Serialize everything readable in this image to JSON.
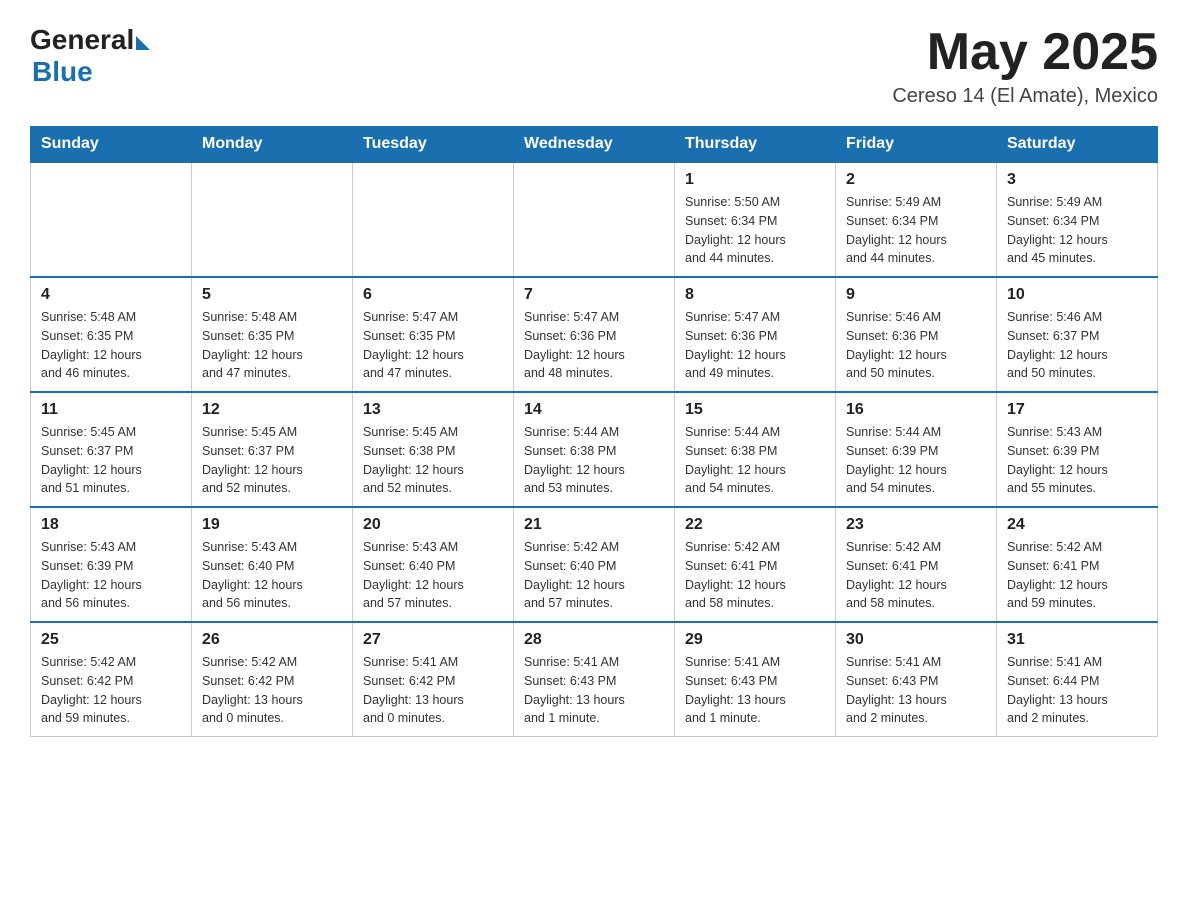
{
  "header": {
    "logo_general": "General",
    "logo_blue": "Blue",
    "month_title": "May 2025",
    "location": "Cereso 14 (El Amate), Mexico"
  },
  "days_of_week": [
    "Sunday",
    "Monday",
    "Tuesday",
    "Wednesday",
    "Thursday",
    "Friday",
    "Saturday"
  ],
  "weeks": [
    [
      {
        "day": "",
        "info": ""
      },
      {
        "day": "",
        "info": ""
      },
      {
        "day": "",
        "info": ""
      },
      {
        "day": "",
        "info": ""
      },
      {
        "day": "1",
        "info": "Sunrise: 5:50 AM\nSunset: 6:34 PM\nDaylight: 12 hours\nand 44 minutes."
      },
      {
        "day": "2",
        "info": "Sunrise: 5:49 AM\nSunset: 6:34 PM\nDaylight: 12 hours\nand 44 minutes."
      },
      {
        "day": "3",
        "info": "Sunrise: 5:49 AM\nSunset: 6:34 PM\nDaylight: 12 hours\nand 45 minutes."
      }
    ],
    [
      {
        "day": "4",
        "info": "Sunrise: 5:48 AM\nSunset: 6:35 PM\nDaylight: 12 hours\nand 46 minutes."
      },
      {
        "day": "5",
        "info": "Sunrise: 5:48 AM\nSunset: 6:35 PM\nDaylight: 12 hours\nand 47 minutes."
      },
      {
        "day": "6",
        "info": "Sunrise: 5:47 AM\nSunset: 6:35 PM\nDaylight: 12 hours\nand 47 minutes."
      },
      {
        "day": "7",
        "info": "Sunrise: 5:47 AM\nSunset: 6:36 PM\nDaylight: 12 hours\nand 48 minutes."
      },
      {
        "day": "8",
        "info": "Sunrise: 5:47 AM\nSunset: 6:36 PM\nDaylight: 12 hours\nand 49 minutes."
      },
      {
        "day": "9",
        "info": "Sunrise: 5:46 AM\nSunset: 6:36 PM\nDaylight: 12 hours\nand 50 minutes."
      },
      {
        "day": "10",
        "info": "Sunrise: 5:46 AM\nSunset: 6:37 PM\nDaylight: 12 hours\nand 50 minutes."
      }
    ],
    [
      {
        "day": "11",
        "info": "Sunrise: 5:45 AM\nSunset: 6:37 PM\nDaylight: 12 hours\nand 51 minutes."
      },
      {
        "day": "12",
        "info": "Sunrise: 5:45 AM\nSunset: 6:37 PM\nDaylight: 12 hours\nand 52 minutes."
      },
      {
        "day": "13",
        "info": "Sunrise: 5:45 AM\nSunset: 6:38 PM\nDaylight: 12 hours\nand 52 minutes."
      },
      {
        "day": "14",
        "info": "Sunrise: 5:44 AM\nSunset: 6:38 PM\nDaylight: 12 hours\nand 53 minutes."
      },
      {
        "day": "15",
        "info": "Sunrise: 5:44 AM\nSunset: 6:38 PM\nDaylight: 12 hours\nand 54 minutes."
      },
      {
        "day": "16",
        "info": "Sunrise: 5:44 AM\nSunset: 6:39 PM\nDaylight: 12 hours\nand 54 minutes."
      },
      {
        "day": "17",
        "info": "Sunrise: 5:43 AM\nSunset: 6:39 PM\nDaylight: 12 hours\nand 55 minutes."
      }
    ],
    [
      {
        "day": "18",
        "info": "Sunrise: 5:43 AM\nSunset: 6:39 PM\nDaylight: 12 hours\nand 56 minutes."
      },
      {
        "day": "19",
        "info": "Sunrise: 5:43 AM\nSunset: 6:40 PM\nDaylight: 12 hours\nand 56 minutes."
      },
      {
        "day": "20",
        "info": "Sunrise: 5:43 AM\nSunset: 6:40 PM\nDaylight: 12 hours\nand 57 minutes."
      },
      {
        "day": "21",
        "info": "Sunrise: 5:42 AM\nSunset: 6:40 PM\nDaylight: 12 hours\nand 57 minutes."
      },
      {
        "day": "22",
        "info": "Sunrise: 5:42 AM\nSunset: 6:41 PM\nDaylight: 12 hours\nand 58 minutes."
      },
      {
        "day": "23",
        "info": "Sunrise: 5:42 AM\nSunset: 6:41 PM\nDaylight: 12 hours\nand 58 minutes."
      },
      {
        "day": "24",
        "info": "Sunrise: 5:42 AM\nSunset: 6:41 PM\nDaylight: 12 hours\nand 59 minutes."
      }
    ],
    [
      {
        "day": "25",
        "info": "Sunrise: 5:42 AM\nSunset: 6:42 PM\nDaylight: 12 hours\nand 59 minutes."
      },
      {
        "day": "26",
        "info": "Sunrise: 5:42 AM\nSunset: 6:42 PM\nDaylight: 13 hours\nand 0 minutes."
      },
      {
        "day": "27",
        "info": "Sunrise: 5:41 AM\nSunset: 6:42 PM\nDaylight: 13 hours\nand 0 minutes."
      },
      {
        "day": "28",
        "info": "Sunrise: 5:41 AM\nSunset: 6:43 PM\nDaylight: 13 hours\nand 1 minute."
      },
      {
        "day": "29",
        "info": "Sunrise: 5:41 AM\nSunset: 6:43 PM\nDaylight: 13 hours\nand 1 minute."
      },
      {
        "day": "30",
        "info": "Sunrise: 5:41 AM\nSunset: 6:43 PM\nDaylight: 13 hours\nand 2 minutes."
      },
      {
        "day": "31",
        "info": "Sunrise: 5:41 AM\nSunset: 6:44 PM\nDaylight: 13 hours\nand 2 minutes."
      }
    ]
  ]
}
